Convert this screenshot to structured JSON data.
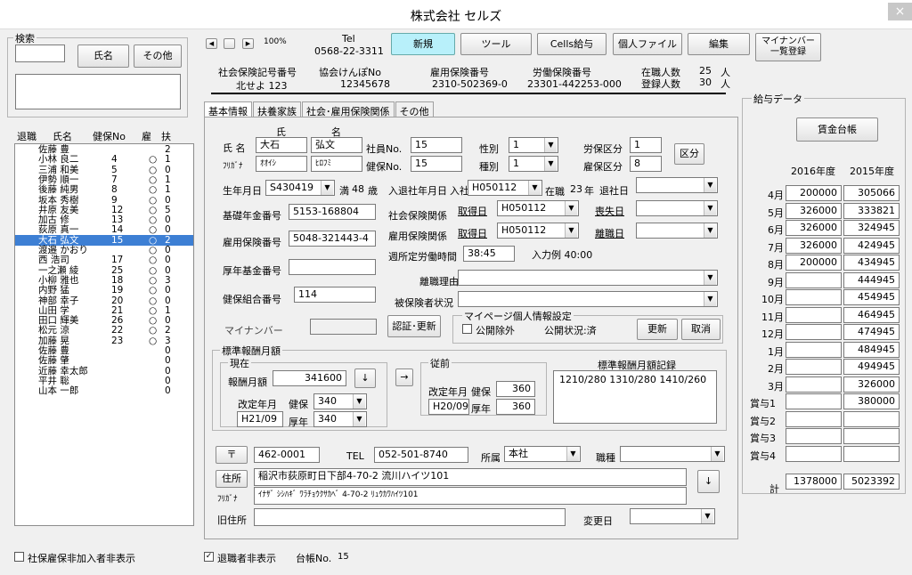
{
  "window": {
    "title": "株式会社 セルズ",
    "close": "×"
  },
  "search": {
    "legend": "検索",
    "btn_name": "氏名",
    "btn_other": "その他"
  },
  "list": {
    "headers": [
      "退職",
      "氏名",
      "健保No",
      "雇",
      "扶"
    ],
    "rows": [
      {
        "name": "佐藤 豊",
        "no": "",
        "ko": "",
        "fu": "2"
      },
      {
        "name": "小林 良二",
        "no": "4",
        "ko": "○",
        "fu": "1"
      },
      {
        "name": "三浦 和美",
        "no": "5",
        "ko": "○",
        "fu": "0"
      },
      {
        "name": "伊勢 順一",
        "no": "7",
        "ko": "○",
        "fu": "1"
      },
      {
        "name": "後藤 純男",
        "no": "8",
        "ko": "○",
        "fu": "1"
      },
      {
        "name": "坂本 秀樹",
        "no": "9",
        "ko": "○",
        "fu": "0"
      },
      {
        "name": "井原 友美",
        "no": "12",
        "ko": "○",
        "fu": "5"
      },
      {
        "name": "加古 修",
        "no": "13",
        "ko": "○",
        "fu": "0"
      },
      {
        "name": "荻原 真一",
        "no": "14",
        "ko": "○",
        "fu": "0"
      },
      {
        "name": "大石 弘文",
        "no": "15",
        "ko": "○",
        "fu": "2"
      },
      {
        "name": "渡邉 かおり",
        "no": "",
        "ko": "○",
        "fu": "0"
      },
      {
        "name": "西 浩司",
        "no": "17",
        "ko": "○",
        "fu": "0"
      },
      {
        "name": "一之瀬 綾",
        "no": "25",
        "ko": "○",
        "fu": "0"
      },
      {
        "name": "小柳 雅也",
        "no": "18",
        "ko": "○",
        "fu": "3"
      },
      {
        "name": "内野 猛",
        "no": "19",
        "ko": "○",
        "fu": "0"
      },
      {
        "name": "神部 幸子",
        "no": "20",
        "ko": "○",
        "fu": "0"
      },
      {
        "name": "山田 学",
        "no": "21",
        "ko": "○",
        "fu": "1"
      },
      {
        "name": "田口 輝美",
        "no": "26",
        "ko": "○",
        "fu": "0"
      },
      {
        "name": "松元 涼",
        "no": "22",
        "ko": "○",
        "fu": "2"
      },
      {
        "name": "加藤 晃",
        "no": "23",
        "ko": "○",
        "fu": "3"
      },
      {
        "name": "佐藤 豊",
        "no": "",
        "ko": "",
        "fu": "0"
      },
      {
        "name": "佐藤 肇",
        "no": "",
        "ko": "",
        "fu": "0"
      },
      {
        "name": "近藤 幸太郎",
        "no": "",
        "ko": "",
        "fu": "0"
      },
      {
        "name": "平井 聡",
        "no": "",
        "ko": "",
        "fu": "0"
      },
      {
        "name": "山本 一郎",
        "no": "",
        "ko": "",
        "fu": "0"
      }
    ]
  },
  "nav": {
    "zoom": "100%",
    "tel_label": "Tel",
    "tel": "0568-22-3311"
  },
  "toolbar": {
    "new": "新規",
    "tools": "ツール",
    "cells": "Cells給与",
    "file": "個人ファイル",
    "edit": "編集",
    "mynumber1": "マイナンバー",
    "mynumber2": "一覧登録"
  },
  "info": {
    "h1": "社会保険記号番号",
    "v1": "北せよ 123",
    "h2": "協会けんぽNo",
    "v2": "12345678",
    "h3": "雇用保険番号",
    "v3": "2310-502369-0",
    "h4": "労働保険番号",
    "v4": "23301-442253-000",
    "h5": "在職人数",
    "v5": "25",
    "u5": "人",
    "h6": "登録人数",
    "v6": "30",
    "u6": "人"
  },
  "tabs": [
    "基本情報",
    "扶養家族",
    "社会･雇用保険関係",
    "その他"
  ],
  "form": {
    "name_label": "氏 名",
    "last_h": "氏",
    "first_h": "名",
    "last": "大石",
    "first": "弘文",
    "kana_label": "ﾌﾘｶﾞﾅ",
    "last_kana": "ｵｵｲｼ",
    "first_kana": "ﾋﾛﾌﾐ",
    "empno_label": "社員No.",
    "empno": "15",
    "kenpo_label": "健保No.",
    "kenpo": "15",
    "sex_label": "性別",
    "sex": "1",
    "type_label": "種別",
    "type": "1",
    "rokbn_label": "労保区分",
    "rokbn": "1",
    "kokbn_label": "雇保区分",
    "kokbn": "8",
    "kbn_btn": "区分",
    "birth_label": "生年月日",
    "birth": "S430419",
    "age_pre": "満",
    "age": "48",
    "age_suf": "歳",
    "join_label": "入退社年月日",
    "in_label": "入社",
    "join": "H050112",
    "tenure_pre": "在職",
    "tenure": "23",
    "tenure_suf": "年",
    "out_label": "退社日",
    "pension_label": "基礎年金番号",
    "pension": "5153-168804",
    "shaho_label": "社会保険関係",
    "get1": "取得日",
    "date1": "H050112",
    "lose1": "喪失日",
    "koyo_label": "雇用保険番号",
    "koyo": "5048-321443-4",
    "koyo2_label": "雇用保険関係",
    "get2": "取得日",
    "date2": "H050112",
    "lose2": "離職日",
    "hours_label": "週所定労働時間",
    "hours": "38:45",
    "example": "入力例 40:00",
    "fund_label": "厚年基金番号",
    "reason_label": "離職理由",
    "union_label": "健保組合番号",
    "union": "114",
    "insured_label": "被保険者状況",
    "mynum_label": "マイナンバー",
    "auth_btn": "認証･更新",
    "mypage_legend": "マイページ個人情報設定",
    "public_ex": "公開除外",
    "public_status": "公開状況:済",
    "update_btn": "更新",
    "cancel_btn": "取消"
  },
  "std": {
    "legend": "標準報酬月額",
    "cur_legend": "現在",
    "pay_label": "報酬月額",
    "pay": "341600",
    "arrow_down": "↓",
    "arrow_right": "→",
    "rev_label": "改定年月",
    "kenpo_label": "健保",
    "kenpo": "340",
    "rev": "H21/09",
    "kounen_label": "厚年",
    "kounen": "340",
    "prev_legend": "従前",
    "prev_rev_label": "改定年月",
    "prev_kenpo_label": "健保",
    "prev_kenpo": "360",
    "prev_rev": "H20/09",
    "prev_kounen_label": "厚年",
    "prev_kounen": "360",
    "record_label": "標準報酬月額記録",
    "record": "1210/280 1310/280 1410/260"
  },
  "addr": {
    "zip_btn": "〒",
    "zip": "462-0001",
    "tel_label": "TEL",
    "tel": "052-501-8740",
    "dept_label": "所属",
    "dept": "本社",
    "job_label": "職種",
    "addr_btn": "住所",
    "addr": "稲沢市荻原町日下部4-70-2 流川ハイツ101",
    "kana_label": "ﾌﾘｶﾞﾅ",
    "kana": "ｲﾅｻﾞ ｼｼﾊｷﾞ ﾜﾗﾁｮｳｸｻｶﾍﾞ 4-70-2 ﾘｭｳｶﾜﾊｲﾂ101",
    "old_label": "旧住所",
    "change_label": "変更日",
    "down": "↓"
  },
  "salary": {
    "legend": "給与データ",
    "ledger_btn": "賃金台帳",
    "col1": "2016年度",
    "col2": "2015年度",
    "rows": [
      {
        "m": "4月",
        "a": "200000",
        "b": "305066"
      },
      {
        "m": "5月",
        "a": "326000",
        "b": "333821"
      },
      {
        "m": "6月",
        "a": "326000",
        "b": "324945"
      },
      {
        "m": "7月",
        "a": "326000",
        "b": "424945"
      },
      {
        "m": "8月",
        "a": "200000",
        "b": "434945"
      },
      {
        "m": "9月",
        "a": "",
        "b": "444945"
      },
      {
        "m": "10月",
        "a": "",
        "b": "454945"
      },
      {
        "m": "11月",
        "a": "",
        "b": "464945"
      },
      {
        "m": "12月",
        "a": "",
        "b": "474945"
      },
      {
        "m": "1月",
        "a": "",
        "b": "484945"
      },
      {
        "m": "2月",
        "a": "",
        "b": "494945"
      },
      {
        "m": "3月",
        "a": "",
        "b": "326000"
      },
      {
        "m": "賞与1",
        "a": "",
        "b": "380000"
      },
      {
        "m": "賞与2",
        "a": "",
        "b": ""
      },
      {
        "m": "賞与3",
        "a": "",
        "b": ""
      },
      {
        "m": "賞与4",
        "a": "",
        "b": ""
      }
    ],
    "total_label": "計",
    "total_a": "1378000",
    "total_b": "5023392"
  },
  "footer": {
    "hide_shaho": "社保雇保非加入者非表示",
    "hide_retired": "退職者非表示",
    "ledger_no_label": "台帳No.",
    "ledger_no": "15"
  }
}
